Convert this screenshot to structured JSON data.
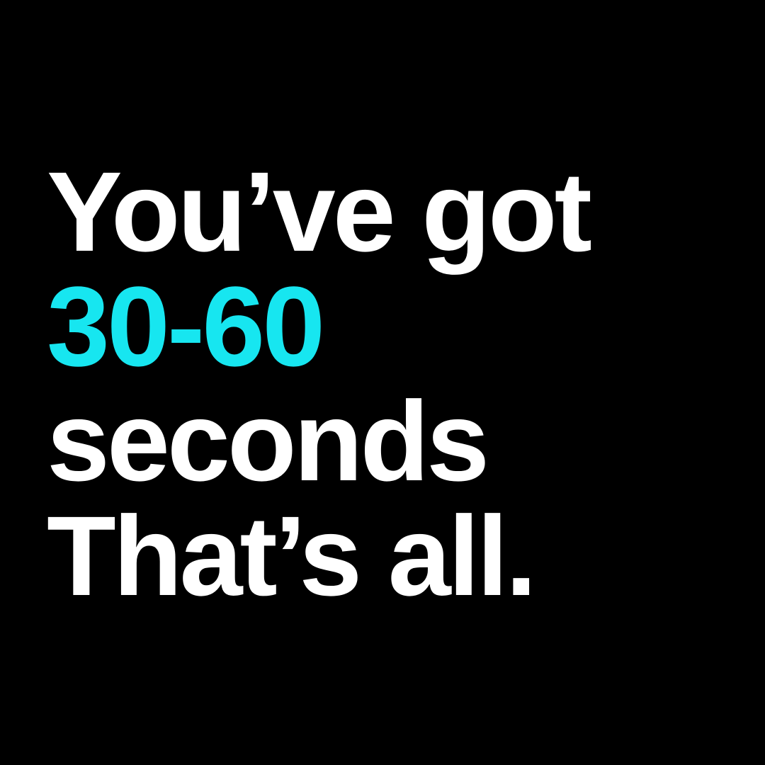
{
  "lines": [
    "You’ve got",
    "30-60",
    "seconds",
    "That’s all."
  ],
  "colors": {
    "background": "#000000",
    "text": "#ffffff",
    "accent": "#17e6f0"
  }
}
